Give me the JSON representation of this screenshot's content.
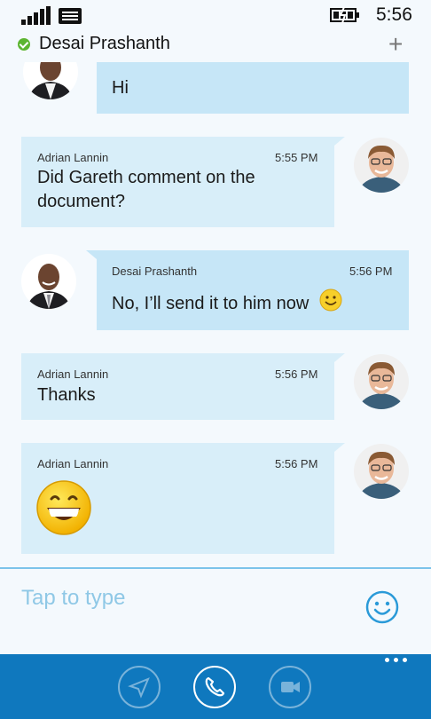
{
  "status_bar": {
    "time": "5:56",
    "icons": [
      "signal-icon",
      "message-icon",
      "battery-charging-icon"
    ]
  },
  "header": {
    "contact_name": "Desai Prashanth",
    "presence": "available",
    "add_icon": "plus-icon"
  },
  "messages": [
    {
      "sender": "Desai Prashanth",
      "direction": "out",
      "time": "",
      "text": "Hi"
    },
    {
      "sender": "Adrian Lannin",
      "direction": "in",
      "time": "5:55 PM",
      "text_lines": [
        "Did Gareth comment on the",
        "document?"
      ]
    },
    {
      "sender": "Desai Prashanth",
      "direction": "out",
      "time": "5:56 PM",
      "text": "No, I’ll send it to him now",
      "emoticon": "smile"
    },
    {
      "sender": "Adrian Lannin",
      "direction": "in",
      "time": "5:56 PM",
      "text": "Thanks"
    },
    {
      "sender": "Adrian Lannin",
      "direction": "in",
      "time": "5:56 PM",
      "emoticon": "big-laugh"
    }
  ],
  "composer": {
    "placeholder": "Tap to type",
    "emoji_icon": "smiley-icon"
  },
  "app_bar": {
    "buttons": [
      {
        "name": "send",
        "icon": "send-icon",
        "enabled": false
      },
      {
        "name": "call",
        "icon": "phone-icon",
        "enabled": true
      },
      {
        "name": "video",
        "icon": "video-icon",
        "enabled": false
      }
    ],
    "more_icon": "more-dots-icon"
  },
  "colors": {
    "accent": "#0f78be",
    "bubble_in": "#d8eef9",
    "bubble_out": "#c6e6f7",
    "presence": "#5cb531"
  }
}
